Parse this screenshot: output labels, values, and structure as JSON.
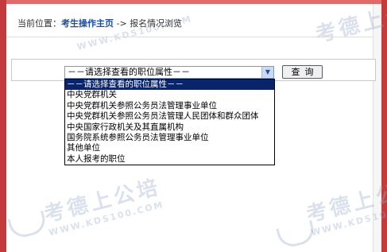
{
  "breadcrumb": {
    "prefix": "当前位置：",
    "home": "考生操作主页",
    "separator": " -> ",
    "current": "报名情况浏览"
  },
  "form": {
    "select_value": "－－请选择查看的职位属性－－",
    "query_button": "查询",
    "options": [
      "－－请选择查看的职位属性－－",
      "中央党群机关",
      "中央党群机关参照公务员法管理事业单位",
      "中央党群机关参照公务员法管理人民团体和群众团体",
      "中央国家行政机关及其直属机构",
      "国务院系统参照公务员法管理事业单位",
      "其他单位",
      "本人报考的职位"
    ],
    "selected_index": 0
  },
  "watermark": {
    "brand": "考德上公培",
    "url": "WWW.KDS100.COM"
  },
  "colors": {
    "frame": "#c43b3b",
    "highlight": "#0a246a",
    "link": "#1b4ea0"
  }
}
